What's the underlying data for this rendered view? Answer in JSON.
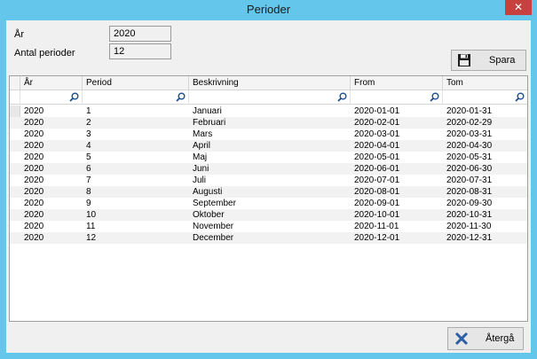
{
  "window": {
    "title": "Perioder",
    "close": "✕"
  },
  "form": {
    "year_label": "År",
    "year_value": "2020",
    "periods_label": "Antal perioder",
    "periods_value": "12"
  },
  "buttons": {
    "save": "Spara",
    "back": "Återgå"
  },
  "grid": {
    "columns": [
      "År",
      "Period",
      "Beskrivning",
      "From",
      "Tom"
    ],
    "rows": [
      [
        "2020",
        "1",
        "Januari",
        "2020-01-01",
        "2020-01-31"
      ],
      [
        "2020",
        "2",
        "Februari",
        "2020-02-01",
        "2020-02-29"
      ],
      [
        "2020",
        "3",
        "Mars",
        "2020-03-01",
        "2020-03-31"
      ],
      [
        "2020",
        "4",
        "April",
        "2020-04-01",
        "2020-04-30"
      ],
      [
        "2020",
        "5",
        "Maj",
        "2020-05-01",
        "2020-05-31"
      ],
      [
        "2020",
        "6",
        "Juni",
        "2020-06-01",
        "2020-06-30"
      ],
      [
        "2020",
        "7",
        "Juli",
        "2020-07-01",
        "2020-07-31"
      ],
      [
        "2020",
        "8",
        "Augusti",
        "2020-08-01",
        "2020-08-31"
      ],
      [
        "2020",
        "9",
        "September",
        "2020-09-01",
        "2020-09-30"
      ],
      [
        "2020",
        "10",
        "Oktober",
        "2020-10-01",
        "2020-10-31"
      ],
      [
        "2020",
        "11",
        "November",
        "2020-11-01",
        "2020-11-30"
      ],
      [
        "2020",
        "12",
        "December",
        "2020-12-01",
        "2020-12-31"
      ]
    ]
  },
  "icons": {
    "save": "floppy-disk-icon",
    "back": "x-icon",
    "filter": "magnifier-icon"
  },
  "colors": {
    "titlebar": "#63c6ea",
    "close": "#c7413f",
    "alt_row": "#f2f2f2"
  }
}
